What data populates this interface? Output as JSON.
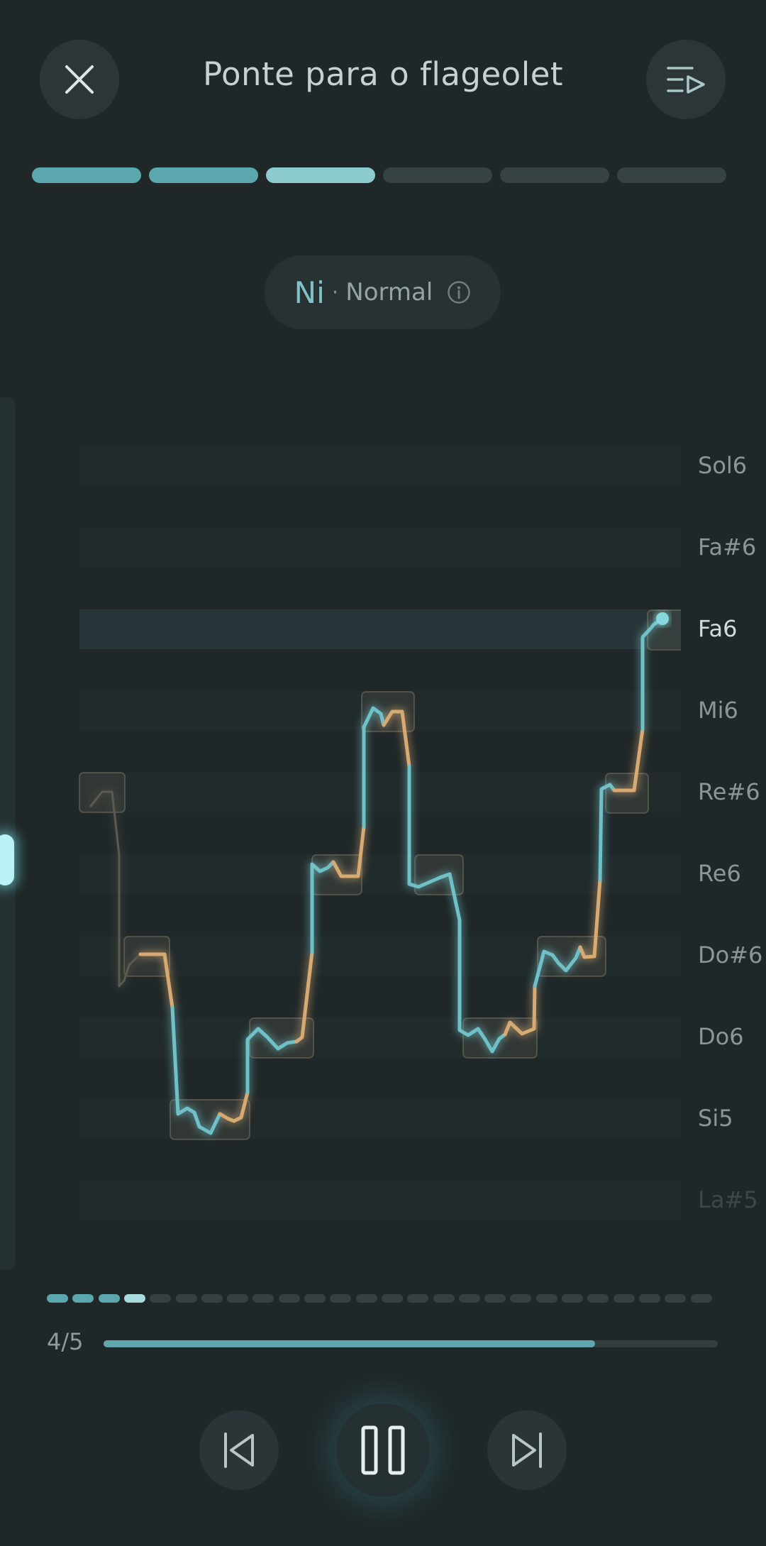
{
  "header": {
    "title": "Ponte para o flageolet",
    "close_icon": "close-icon",
    "queue_icon": "playlist-play-icon"
  },
  "step_progress": {
    "total": 6,
    "completed": 2,
    "current_index": 2
  },
  "technique": {
    "name": "Ni",
    "separator": "·",
    "mode": "Normal",
    "info_icon": "info-icon"
  },
  "pitch_view": {
    "note_labels": [
      "Sol6",
      "Fa#6",
      "Fa6",
      "Mi6",
      "Re#6",
      "Re6",
      "Do#6",
      "Do6",
      "Si5",
      "La#5"
    ],
    "active_note": "Fa6",
    "colors": {
      "on_pitch": "#6fc1c7",
      "off_pitch": "#d8aa73",
      "faded": "#5d5a50"
    }
  },
  "phrase_progress": {
    "total": 26,
    "completed": 3,
    "current_index": 3
  },
  "playback": {
    "count_label": "4/5",
    "progress": 0.8
  },
  "controls": {
    "prev_icon": "skip-previous-icon",
    "pause_icon": "pause-icon",
    "next_icon": "skip-next-icon"
  }
}
